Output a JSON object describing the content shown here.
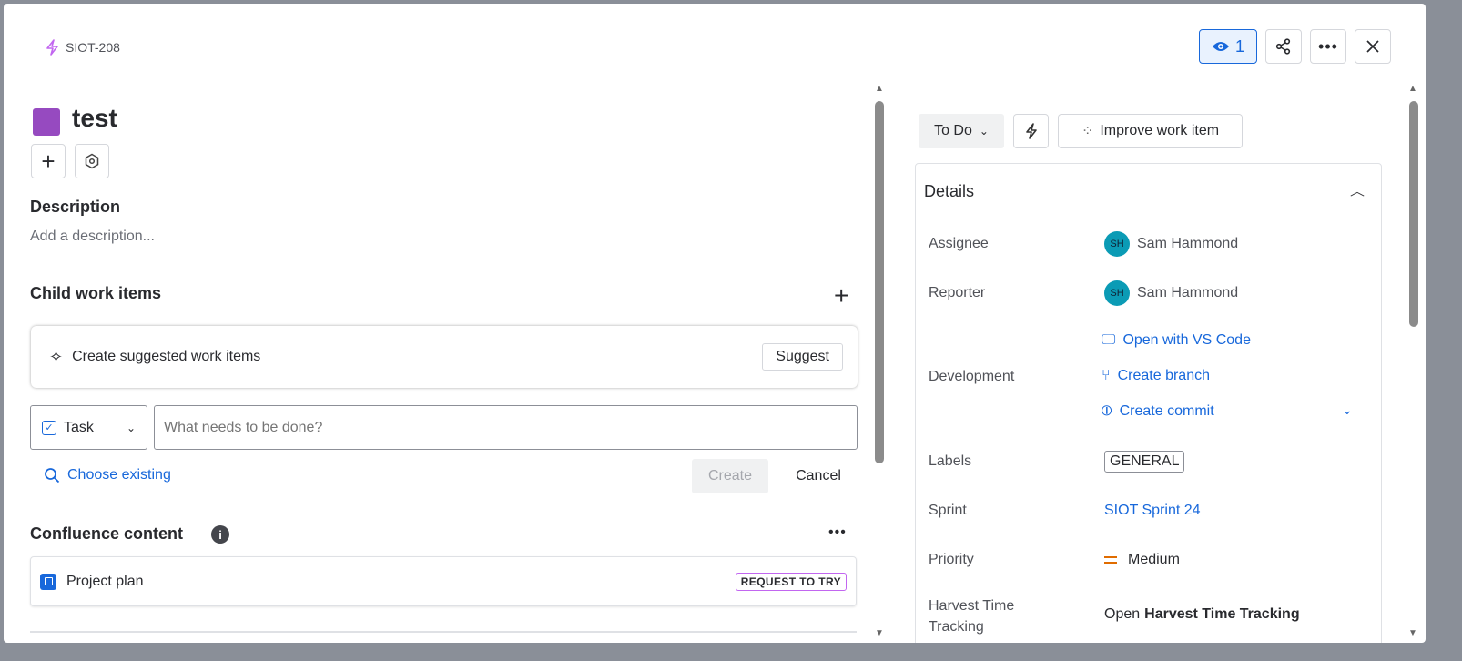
{
  "header": {
    "key": "SIOT-208",
    "watch_count": "1"
  },
  "title": "test",
  "description": {
    "heading": "Description",
    "placeholder": "Add a description..."
  },
  "child": {
    "heading": "Child work items",
    "suggest_text": "Create suggested work items",
    "suggest_btn": "Suggest",
    "type": "Task",
    "input_placeholder": "What needs to be done?",
    "choose_existing": "Choose existing",
    "create": "Create",
    "cancel": "Cancel"
  },
  "confluence": {
    "heading": "Confluence content",
    "item": "Project plan",
    "badge": "REQUEST TO TRY"
  },
  "status": {
    "value": "To Do",
    "improve": "Improve work item"
  },
  "details": {
    "heading": "Details",
    "assignee_label": "Assignee",
    "assignee": "Sam Hammond",
    "assignee_initials": "SH",
    "reporter_label": "Reporter",
    "reporter": "Sam Hammond",
    "reporter_initials": "SH",
    "development_label": "Development",
    "vscode": "Open with VS Code",
    "branch": "Create branch",
    "commit": "Create commit",
    "labels_label": "Labels",
    "label": "GENERAL",
    "sprint_label": "Sprint",
    "sprint": "SIOT Sprint 24",
    "priority_label": "Priority",
    "priority": "Medium",
    "harvest_label": "Harvest Time Tracking",
    "harvest_open": "Open",
    "harvest_name": "Harvest Time Tracking"
  },
  "colors": {
    "accent": "#1868db",
    "issue_type": "#964ac0",
    "priority": "#e06c00"
  }
}
